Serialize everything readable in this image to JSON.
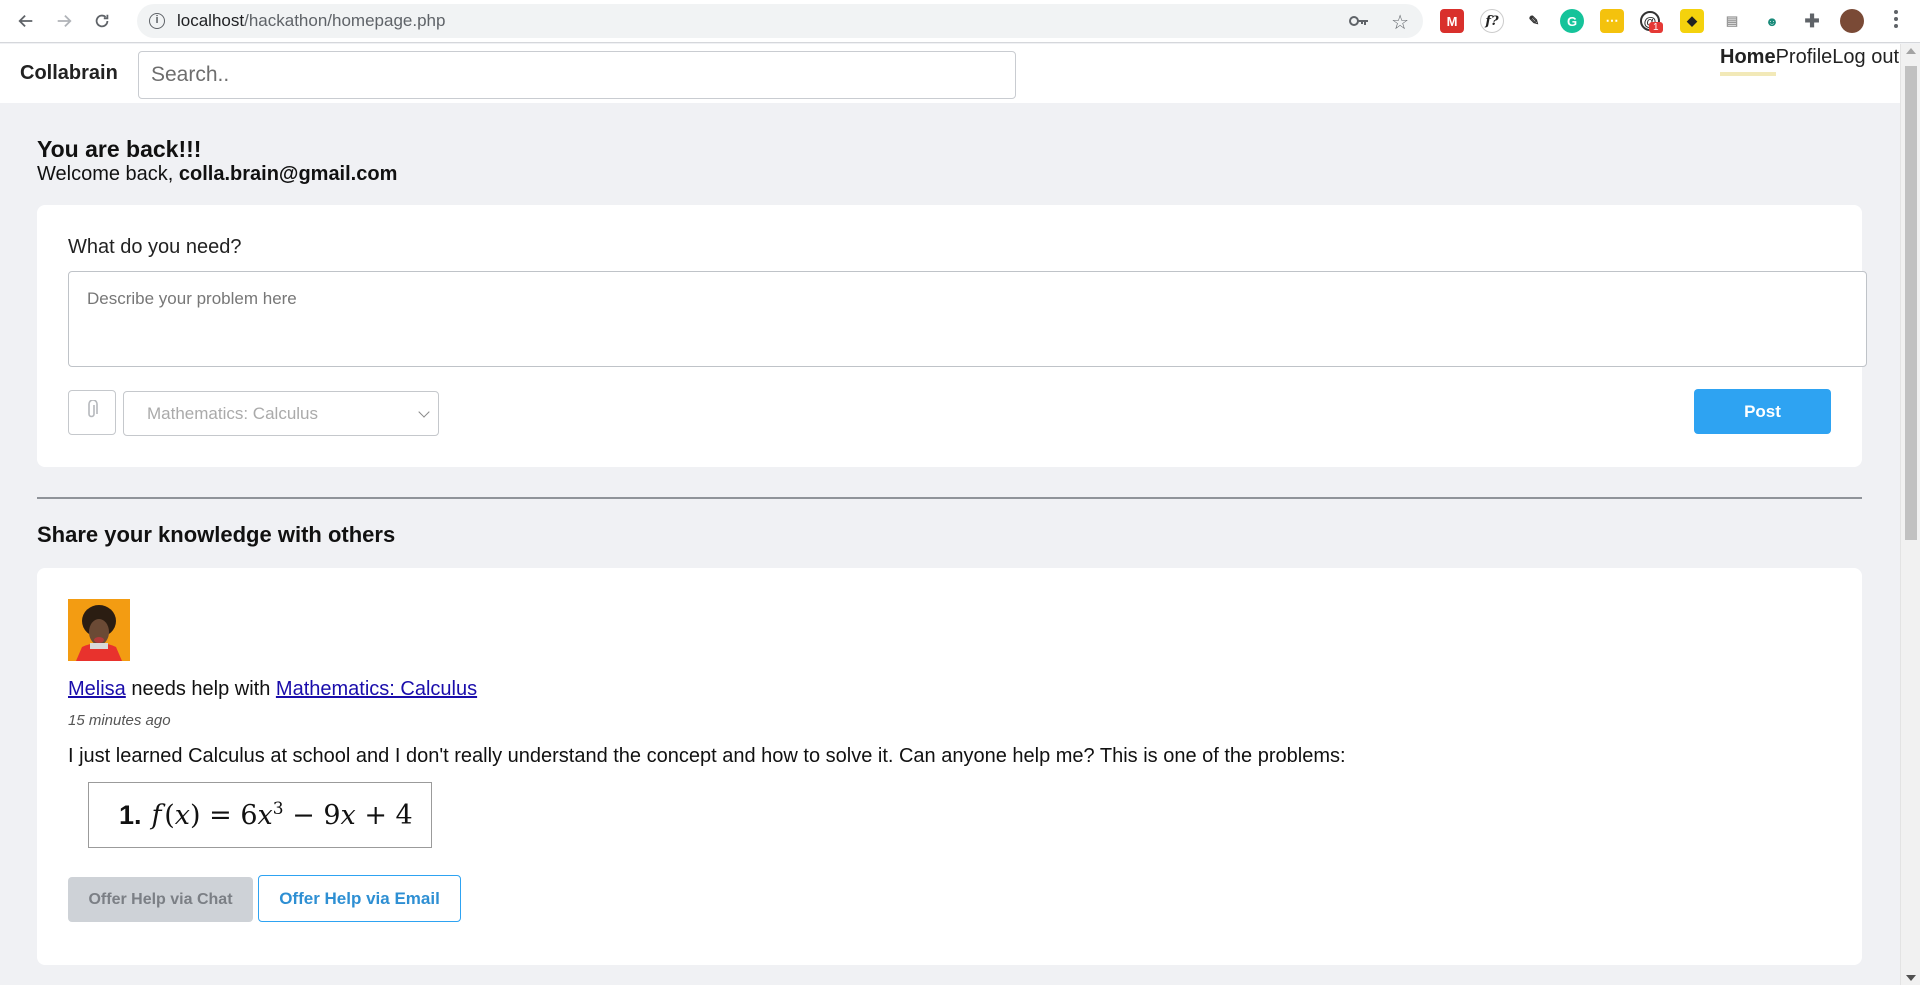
{
  "browser": {
    "url_host": "localhost",
    "url_path": "/hackathon/homepage.php",
    "extension_badge": "1"
  },
  "app": {
    "brand": "Collabrain",
    "search_placeholder": "Search..",
    "nav": {
      "home": "Home",
      "profile": "Profile",
      "logout": "Log out"
    }
  },
  "greeting": {
    "title": "You are back!!!",
    "welcome_prefix": "Welcome back, ",
    "email": "colla.brain@gmail.com"
  },
  "ask": {
    "label": "What do you need?",
    "placeholder": "Describe your problem here",
    "subject_selected": "Mathematics: Calculus",
    "post_label": "Post"
  },
  "share": {
    "title": "Share your knowledge with others"
  },
  "post": {
    "author": "Melisa",
    "needs_text": " needs help with ",
    "subject": "Mathematics: Calculus",
    "time": "15 minutes ago",
    "body": "I just learned Calculus at school and I don't really understand the concept and how to solve it. Can anyone help me? This is one of the problems:",
    "formula_number": "1.",
    "chat_label": "Offer Help via Chat",
    "email_label": "Offer Help via Email"
  },
  "colors": {
    "accent": "#2ea3f2",
    "page_bg": "#f0f1f4",
    "link": "#1a0dab",
    "nav_active_underline": "#f2e9b8"
  },
  "icons": [
    "back-arrow-icon",
    "forward-arrow-icon",
    "reload-icon",
    "info-icon",
    "key-icon",
    "star-icon",
    "paperclip-icon",
    "chevron-down-icon",
    "extensions-icon",
    "kebab-menu-icon"
  ]
}
